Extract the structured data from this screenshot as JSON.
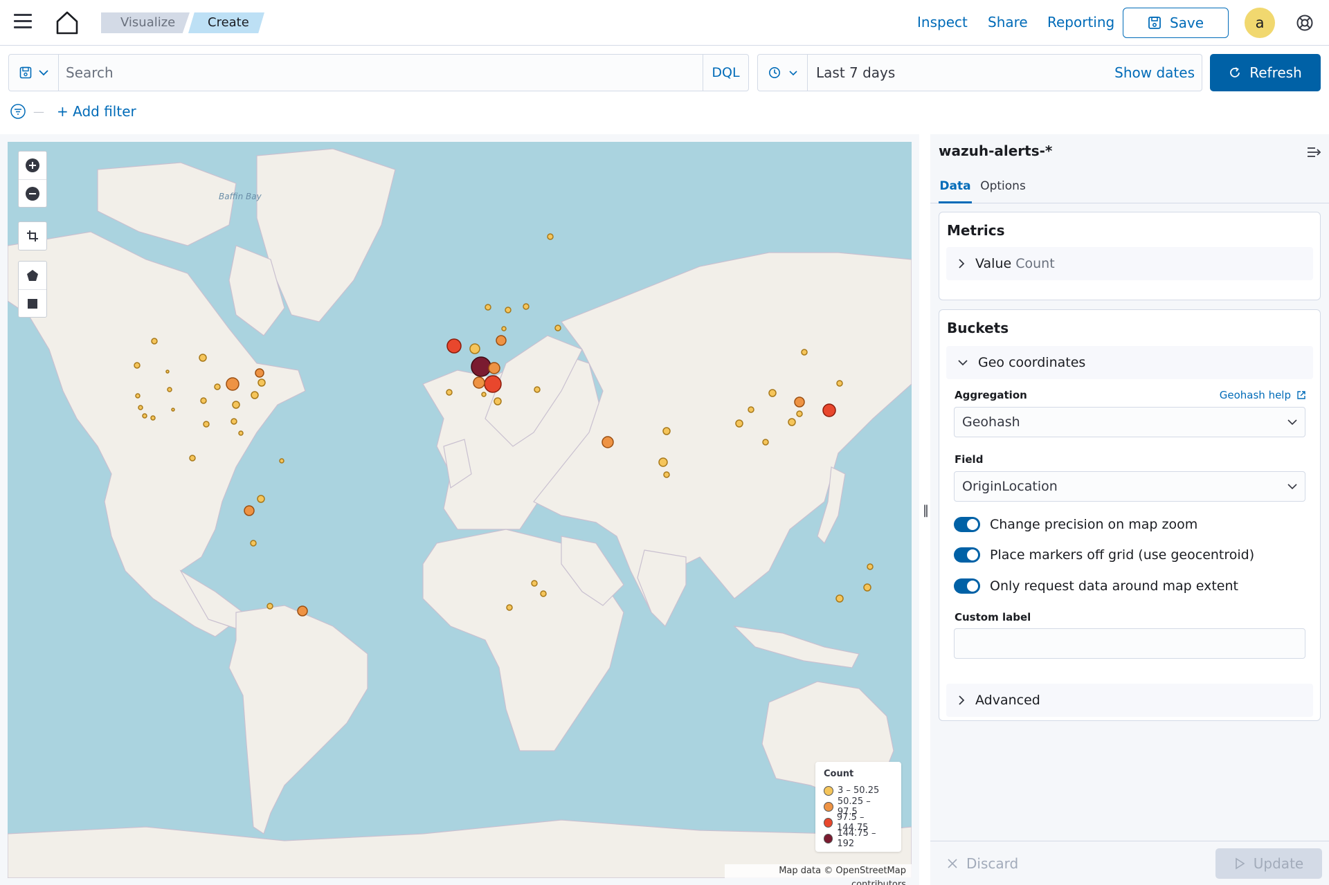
{
  "header": {
    "breadcrumbs": [
      "Visualize",
      "Create"
    ],
    "links": {
      "inspect": "Inspect",
      "share": "Share",
      "reporting": "Reporting"
    },
    "save_label": "Save",
    "avatar_initial": "a"
  },
  "query": {
    "search_placeholder": "Search",
    "language": "DQL",
    "time_range": "Last 7 days",
    "show_dates": "Show dates",
    "refresh_label": "Refresh",
    "add_filter": "+ Add filter"
  },
  "map": {
    "attribution": "Map data © OpenStreetMap contributors",
    "sea_label": "Baffin Bay",
    "legend": {
      "title": "Count",
      "ranges": [
        {
          "label": "3 – 50.25",
          "color": "#f5c55b"
        },
        {
          "label": "50.25 – 97.5",
          "color": "#ee9344"
        },
        {
          "label": "97.5 – 144.75",
          "color": "#e8472d"
        },
        {
          "label": "144.75 – 192",
          "color": "#7a1b30"
        }
      ]
    },
    "colors": {
      "water": "#aad3df",
      "land": "#f2efe9",
      "border": "#c9c0d0"
    }
  },
  "sidebar": {
    "index_pattern": "wazuh-alerts-*",
    "tabs": [
      "Data",
      "Options"
    ],
    "metrics": {
      "title": "Metrics",
      "item_label": "Value",
      "item_detail": "Count"
    },
    "buckets": {
      "title": "Buckets",
      "item_label": "Geo coordinates",
      "aggregation_label": "Aggregation",
      "aggregation_help": "Geohash help",
      "aggregation_value": "Geohash",
      "field_label": "Field",
      "field_value": "OriginLocation",
      "toggles": [
        "Change precision on map zoom",
        "Place markers off grid (use geocentroid)",
        "Only request data around map extent"
      ],
      "custom_label": "Custom label",
      "advanced": "Advanced"
    },
    "discard": "Discard",
    "update": "Update"
  }
}
